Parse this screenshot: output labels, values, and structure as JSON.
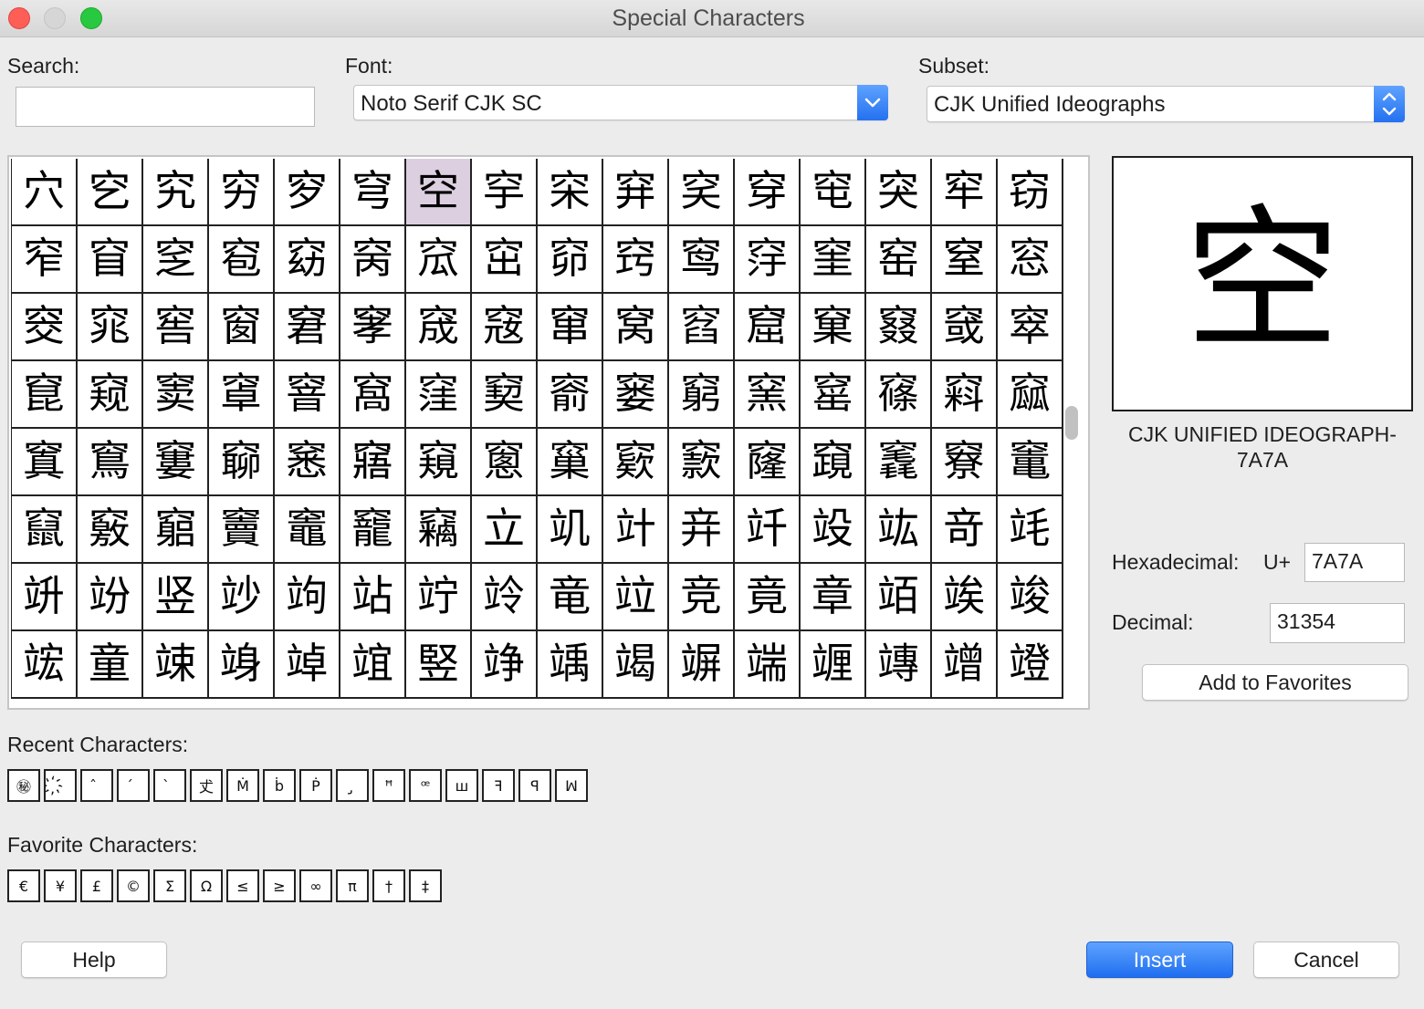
{
  "window": {
    "title": "Special Characters"
  },
  "search": {
    "label": "Search:",
    "value": ""
  },
  "font": {
    "label": "Font:",
    "value": "Noto Serif CJK SC"
  },
  "subset": {
    "label": "Subset:",
    "value": "CJK Unified Ideographs"
  },
  "grid": {
    "selected_index": 6,
    "characters": [
      "穴",
      "穵",
      "究",
      "穷",
      "穸",
      "穹",
      "空",
      "穻",
      "穼",
      "穽",
      "穾",
      "穿",
      "窀",
      "突",
      "窂",
      "窃",
      "窄",
      "窅",
      "窆",
      "窇",
      "窈",
      "窉",
      "窊",
      "窋",
      "窌",
      "窍",
      "窎",
      "窏",
      "窐",
      "窑",
      "窒",
      "窓",
      "窔",
      "窕",
      "窖",
      "窗",
      "窘",
      "窙",
      "窚",
      "窛",
      "窜",
      "窝",
      "窞",
      "窟",
      "窠",
      "窡",
      "窢",
      "窣",
      "窤",
      "窥",
      "窦",
      "窧",
      "窨",
      "窩",
      "窪",
      "窫",
      "窬",
      "窭",
      "窮",
      "窯",
      "窰",
      "窱",
      "窲",
      "窳",
      "窴",
      "窵",
      "窶",
      "窷",
      "窸",
      "窹",
      "窺",
      "窻",
      "窼",
      "窽",
      "窾",
      "窿",
      "竀",
      "竁",
      "竂",
      "竃",
      "竄",
      "竅",
      "竆",
      "竇",
      "竈",
      "竉",
      "竊",
      "立",
      "竌",
      "竍",
      "竎",
      "竏",
      "竐",
      "竑",
      "竒",
      "竓",
      "竔",
      "竕",
      "竖",
      "竗",
      "竘",
      "站",
      "竚",
      "竛",
      "竜",
      "竝",
      "竞",
      "竟",
      "章",
      "竡",
      "竢",
      "竣",
      "竤",
      "童",
      "竦",
      "竧",
      "竨",
      "竩",
      "竪",
      "竫",
      "竬",
      "竭",
      "竮",
      "端",
      "竰",
      "竱",
      "竲",
      "竳"
    ]
  },
  "preview": {
    "character": "空",
    "name": "CJK UNIFIED IDEOGRAPH-7A7A"
  },
  "code": {
    "hex_label": "Hexadecimal:",
    "hex_prefix": "U+",
    "hex_value": "7A7A",
    "dec_label": "Decimal:",
    "dec_value": "31354"
  },
  "buttons": {
    "add_favorites": "Add to Favorites",
    "help": "Help",
    "insert": "Insert",
    "cancel": "Cancel"
  },
  "recent": {
    "label": "Recent Characters:",
    "items": [
      "㊙",
      "҉",
      "̂",
      "́",
      "̀",
      "𠀋",
      "Ṁ",
      "ḃ",
      "Ṗ",
      "̡",
      "ꟸ",
      "ꟹ",
      "ꟺ",
      "ꟻ",
      "ꟼ",
      "ꟽ"
    ]
  },
  "favorites": {
    "label": "Favorite Characters:",
    "items": [
      "€",
      "¥",
      "£",
      "©",
      "Σ",
      "Ω",
      "≤",
      "≥",
      "∞",
      "π",
      "†",
      "‡"
    ]
  }
}
